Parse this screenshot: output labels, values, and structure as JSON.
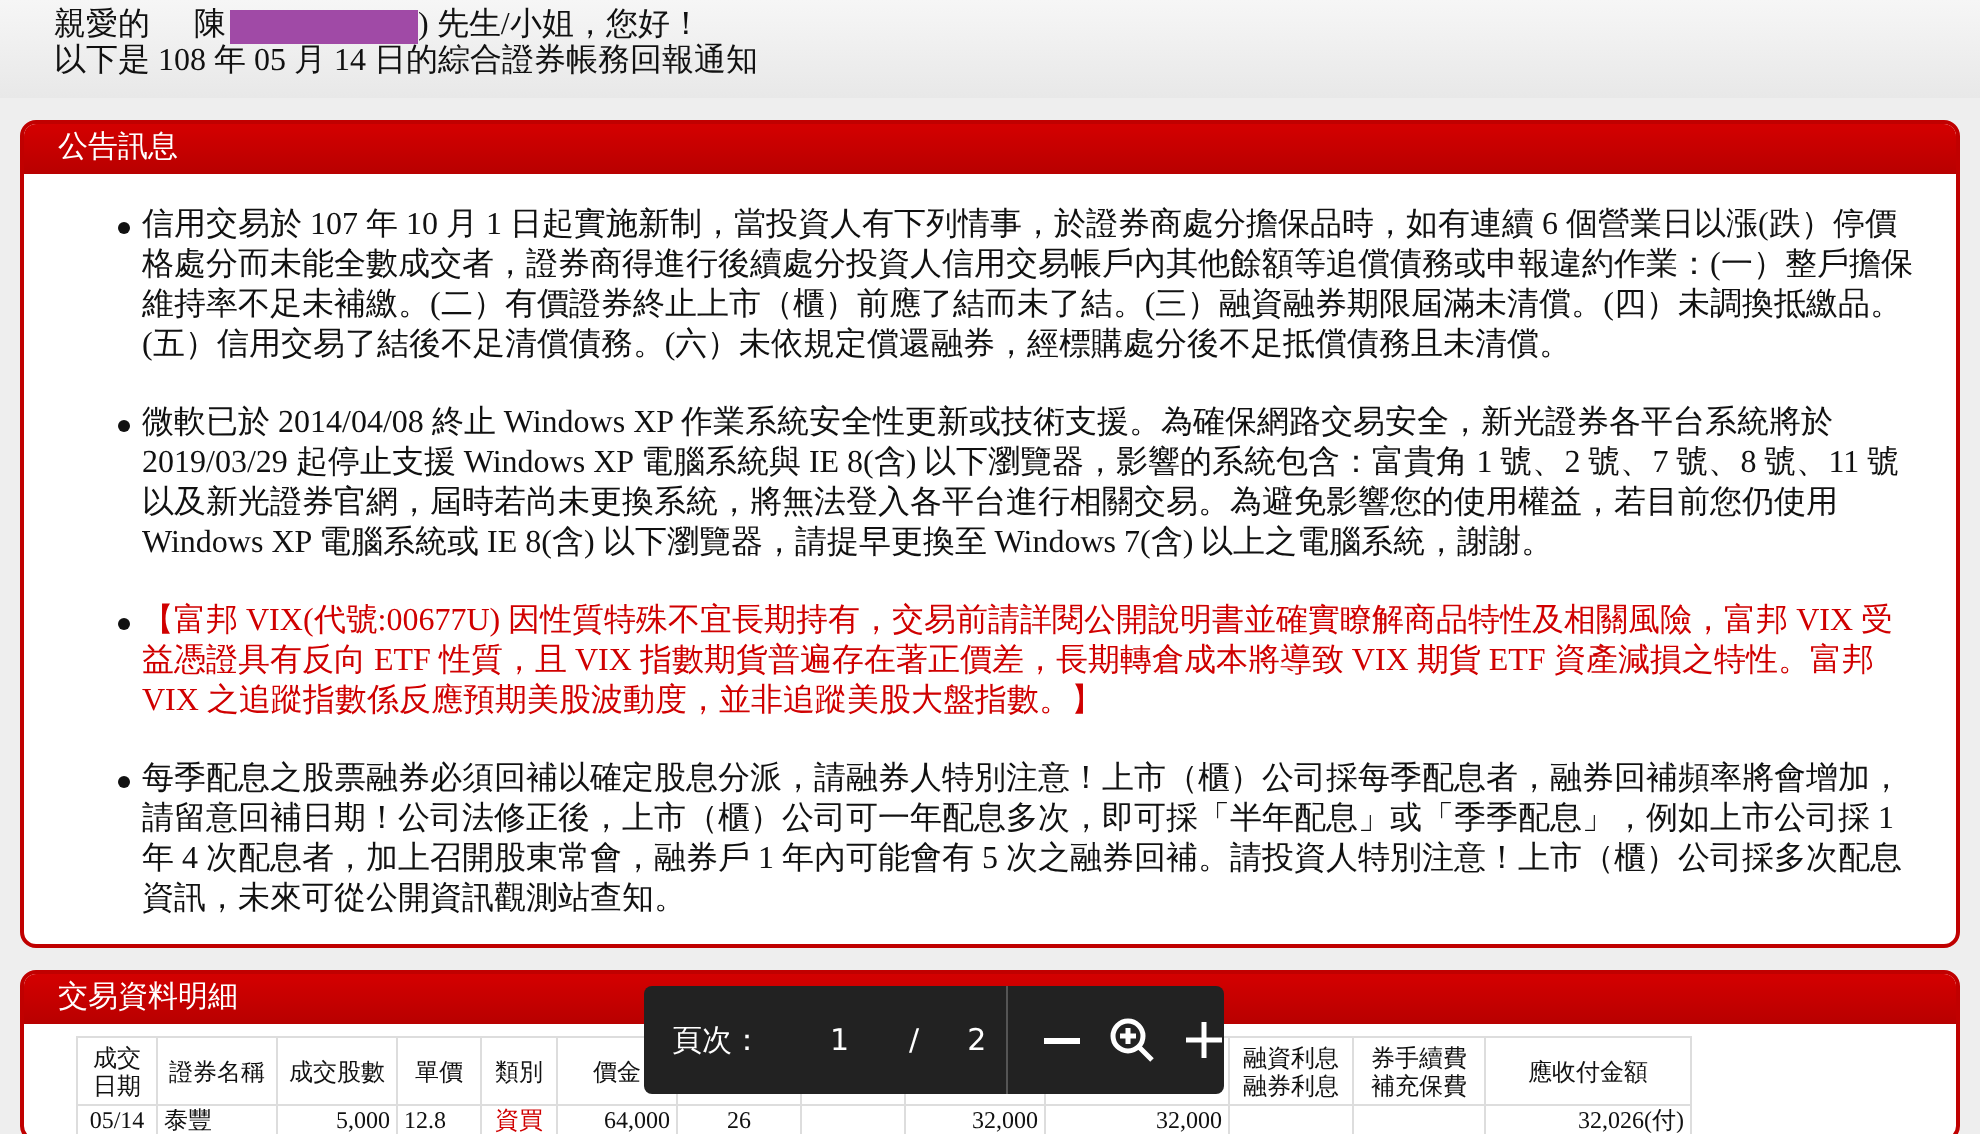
{
  "greeting": {
    "salutation": "親愛的",
    "name_start": "陳",
    "name_end": ") 先生/小姐，您好！",
    "subtitle": "以下是 108 年 05 月 14 日的綜合證券帳務回報通知"
  },
  "announcements": {
    "title": "公告訊息",
    "items": [
      {
        "kind": "normal",
        "text": "信用交易於 107 年 10 月 1 日起實施新制，當投資人有下列情事，於證券商處分擔保品時，如有連續 6 個營業日以漲(跌）停價格處分而未能全數成交者，證券商得進行後續處分投資人信用交易帳戶內其他餘額等追償債務或申報違約作業：(一）整戶擔保維持率不足未補繳。(二）有價證券終止上市（櫃）前應了結而未了結。(三）融資融券期限屆滿未清償。(四）未調換抵繳品。(五）信用交易了結後不足清償債務。(六）未依規定償還融券，經標購處分後不足抵償債務且未清償。"
      },
      {
        "kind": "normal",
        "text": "微軟已於 2014/04/08 終止 Windows XP 作業系統安全性更新或技術支援。為確保網路交易安全，新光證券各平台系統將於 2019/03/29 起停止支援 Windows XP 電腦系統與 IE 8(含) 以下瀏覽器，影響的系統包含：富貴角 1 號、2 號、7 號、8 號、11 號以及新光證券官網，屆時若尚未更換系統，將無法登入各平台進行相關交易。為避免影響您的使用權益，若目前您仍使用 Windows XP 電腦系統或 IE 8(含) 以下瀏覽器，請提早更換至 Windows 7(含) 以上之電腦系統，謝謝。"
      },
      {
        "kind": "alert",
        "text": "【富邦 VIX(代號:00677U) 因性質特殊不宜長期持有，交易前請詳閱公開說明書並確實瞭解商品特性及相關風險，富邦 VIX 受益憑證具有反向 ETF 性質，且 VIX 指數期貨普遍存在著正價差，長期轉倉成本將導致 VIX 期貨 ETF 資產減損之特性。富邦 VIX 之追蹤指數係反應預期美股波動度，並非追蹤美股大盤指數。】"
      },
      {
        "kind": "normal",
        "text": "每季配息之股票融券必須回補以確定股息分派，請融券人特別注意！上市（櫃）公司採每季配息者，融券回補頻率將會增加，請留意回補日期！公司法修正後，上市（櫃）公司可一年配息多次，即可採「半年配息」或「季季配息」，例如上市公司採 1 年 4 次配息者，加上召開股東常會，融券戶 1 年內可能會有 5 次之融券回補。請投資人特別注意！上市（櫃）公司採多次配息資訊，未來可從公開資訊觀測站查知。"
      }
    ]
  },
  "trades": {
    "title": "交易資料明細",
    "columns": [
      {
        "label": "成交日期",
        "kind": "center"
      },
      {
        "label": "證券名稱",
        "kind": "text"
      },
      {
        "label": "成交股數",
        "kind": "number"
      },
      {
        "label": "單價",
        "kind": "text"
      },
      {
        "label": "類別",
        "kind": "action"
      },
      {
        "label": "價金",
        "kind": "number"
      },
      {
        "kind": "center"
      },
      {
        "kind": "number"
      },
      {
        "kind": "number"
      },
      {
        "kind": "number"
      },
      {
        "label": "融資利息融券利息",
        "kind": "number"
      },
      {
        "label": "券手續費補充保費",
        "kind": "number"
      },
      {
        "label": "應收付金額",
        "kind": "number"
      }
    ],
    "rows": [
      {
        "cells": [
          "05/14",
          "泰豐",
          "5,000",
          "12.8",
          "資買",
          "64,000",
          "26",
          "",
          "32,000",
          "32,000",
          "",
          "",
          "32,026(付)"
        ]
      }
    ]
  },
  "pager": {
    "label": "頁次：",
    "current": "1",
    "separator": "/",
    "total": "2"
  }
}
